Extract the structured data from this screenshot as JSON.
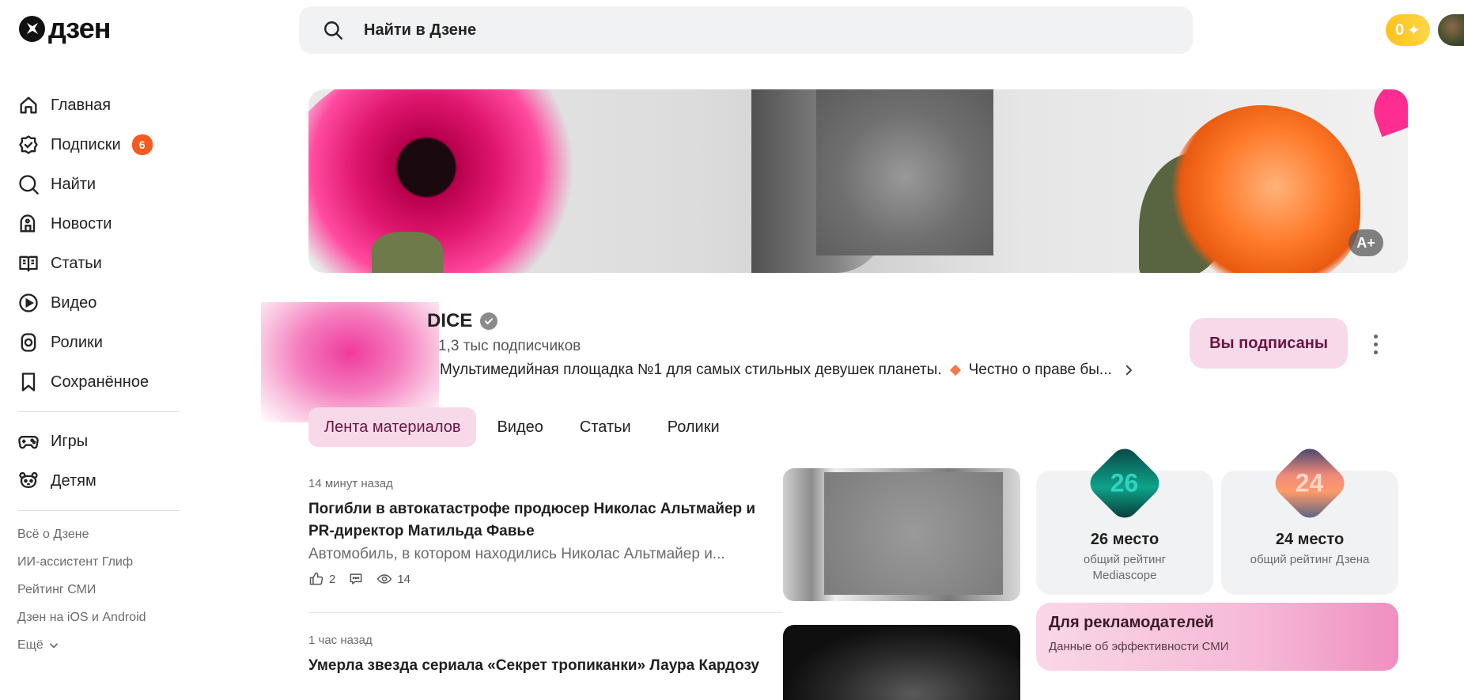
{
  "header": {
    "logo_text": "дзен",
    "search_placeholder": "Найти в Дзене",
    "coins": "0"
  },
  "sidebar": {
    "items": [
      {
        "label": "Главная",
        "icon": "home-icon"
      },
      {
        "label": "Подписки",
        "icon": "subscriptions-icon",
        "badge": "6"
      },
      {
        "label": "Найти",
        "icon": "search-icon"
      },
      {
        "label": "Новости",
        "icon": "news-icon"
      },
      {
        "label": "Статьи",
        "icon": "articles-icon"
      },
      {
        "label": "Видео",
        "icon": "video-icon"
      },
      {
        "label": "Ролики",
        "icon": "shorts-icon"
      },
      {
        "label": "Сохранённое",
        "icon": "bookmark-icon"
      }
    ],
    "extra": [
      {
        "label": "Игры",
        "icon": "gamepad-icon"
      },
      {
        "label": "Детям",
        "icon": "kids-icon"
      }
    ],
    "footer_links": [
      "Всё о Дзене",
      "ИИ-ассистент Глиф",
      "Рейтинг СМИ",
      "Дзен на iOS и Android",
      "Ещё"
    ]
  },
  "banner": {
    "font_button": "A+"
  },
  "channel": {
    "name": "DICE",
    "subscribers": "1,3 тыс подписчиков",
    "description_1": "Мультимедийная площадка №1 для самых стильных девушек планеты.",
    "description_2": "Честно о праве бы...",
    "subscribe_label": "Вы подписаны"
  },
  "tabs": [
    "Лента материалов",
    "Видео",
    "Статьи",
    "Ролики"
  ],
  "feed": [
    {
      "time": "14 минут назад",
      "title": "Погибли в автокатастрофе продюсер Николас Альтмайер и PR-директор Матильда Фавье",
      "snippet": "Автомобиль, в котором находились Николас Альтмайер и...",
      "likes": "2",
      "views": "14"
    },
    {
      "time": "1 час назад",
      "title": "Умерла звезда сериала «Секрет тропиканки» Лаура Кардозу"
    }
  ],
  "ratings": [
    {
      "number": "26",
      "place": "26 место",
      "desc": "общий рейтинг Mediascope"
    },
    {
      "number": "24",
      "place": "24 место",
      "desc": "общий рейтинг Дзена"
    }
  ],
  "ad": {
    "title": "Для рекламодателей",
    "subtitle": "Данные об эффективности СМИ"
  },
  "colors": {
    "accent_pink": "#f8d9ea",
    "badge_orange": "#f55a1f",
    "coins_yellow": "#ffc21a"
  }
}
